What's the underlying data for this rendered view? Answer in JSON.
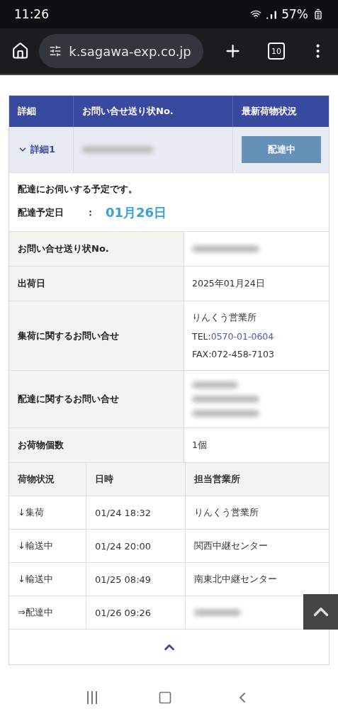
{
  "status_bar": {
    "time": "11:26",
    "battery": "57%"
  },
  "browser": {
    "url": "k.sagawa-exp.co.jp",
    "tab_count": "10"
  },
  "summary": {
    "columns": [
      "詳細",
      "お問い合せ送り状No.",
      "最新荷物状況"
    ],
    "row": {
      "toggle": "詳細1",
      "expanded": true,
      "status": "配達中"
    }
  },
  "message": {
    "text": "配達にお伺いする予定です。",
    "date_label": "配達予定日",
    "separator": "：",
    "date": "01月26日"
  },
  "details": [
    {
      "label": "お問い合せ送り状No.",
      "lines": [
        {
          "kind": "redacted"
        }
      ]
    },
    {
      "label": "出荷日",
      "lines": [
        {
          "kind": "text",
          "text": "2025年01月24日"
        }
      ]
    },
    {
      "label": "集荷に関するお問い合せ",
      "lines": [
        {
          "kind": "text",
          "text": "りんくう営業所"
        },
        {
          "kind": "phone",
          "prefix": "TEL:",
          "text": "0570-01-0604"
        },
        {
          "kind": "text",
          "text": "FAX:072-458-7103"
        }
      ]
    },
    {
      "label": "配達に関するお問い合せ",
      "lines": [
        {
          "kind": "redacted"
        },
        {
          "kind": "redacted"
        },
        {
          "kind": "redacted"
        }
      ]
    },
    {
      "label": "お荷物個数",
      "lines": [
        {
          "kind": "text",
          "text": "1個"
        }
      ]
    }
  ],
  "history": {
    "columns": [
      "荷物状況",
      "日時",
      "担当営業所"
    ],
    "rows": [
      {
        "status": "↓集荷",
        "time": "01/24 18:32",
        "office": "りんくう営業所"
      },
      {
        "status": "↓輸送中",
        "time": "01/24 20:00",
        "office": "関西中継センター"
      },
      {
        "status": "↓輸送中",
        "time": "01/25 08:49",
        "office": "南東北中継センター"
      },
      {
        "status": "⇒配達中",
        "time": "01/26 09:26",
        "office": null
      }
    ]
  }
}
